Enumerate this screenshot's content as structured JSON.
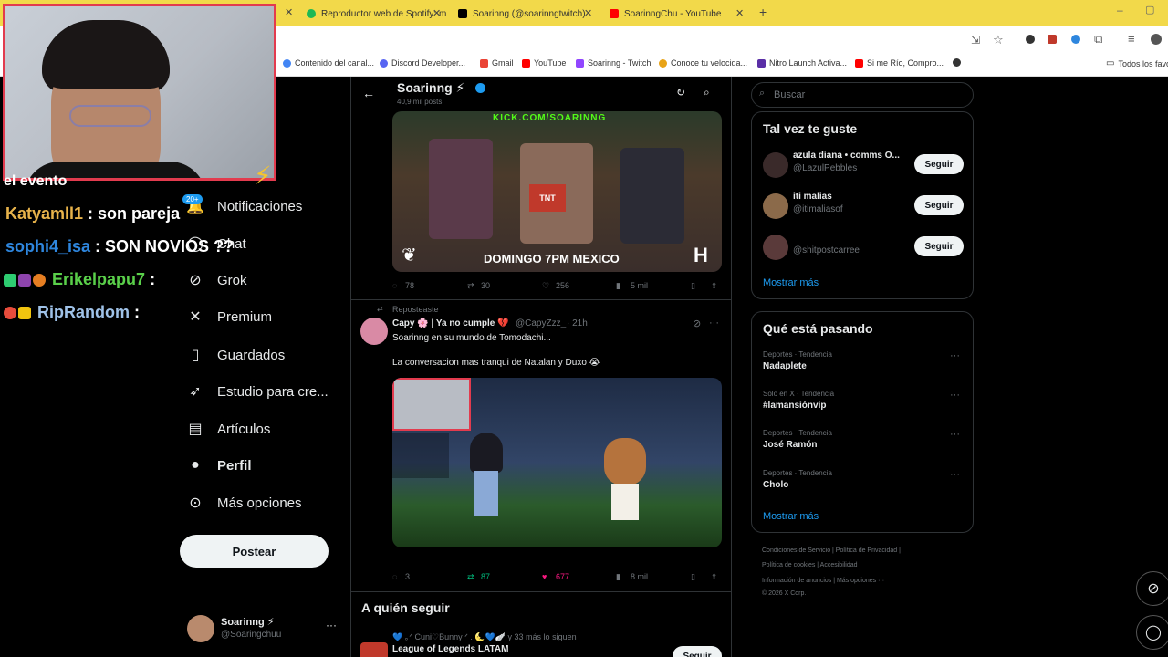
{
  "browser": {
    "tabs": [
      {
        "title": "Reproductor web de Spotify: m",
        "color": "#1db954"
      },
      {
        "title": "Soarinng (@soarinngtwitch) | T",
        "color": "#000000"
      },
      {
        "title": "SoarinngChu - YouTube",
        "color": "#ff0000"
      }
    ],
    "new_tab": "+",
    "bookmarks": [
      {
        "label": "Contenido del canal...",
        "color": "#4285f4"
      },
      {
        "label": "Discord Developer...",
        "color": "#5865f2"
      },
      {
        "label": "Gmail",
        "color": "#ea4335"
      },
      {
        "label": "YouTube",
        "color": "#ff0000"
      },
      {
        "label": "Soarinng - Twitch",
        "color": "#9146ff"
      },
      {
        "label": "Conoce tu velocida...",
        "color": "#e8a317"
      },
      {
        "label": "Nitro Launch Activa...",
        "color": "#5a2ea6"
      },
      {
        "label": "Si me Río, Compro...",
        "color": "#ff0000"
      },
      {
        "label": "",
        "color": "#333333"
      }
    ],
    "all_bookmarks": "Todos los favo"
  },
  "overlay": {
    "chat_top": "el evento",
    "messages": [
      {
        "user": "Katyamll1",
        "text": " : son pareja",
        "color": "#e8b34b"
      },
      {
        "user": "sophi4_isa",
        "text": " : SON NOVIOS ??",
        "color": "#2e86de"
      },
      {
        "user": "Erikelpapu7",
        "text": " :",
        "color": "#5ad04a"
      },
      {
        "user": "RipRandom",
        "text": " :",
        "color": "#9fc2e8"
      }
    ],
    "badge_count": "20+"
  },
  "nav": {
    "items": [
      {
        "label": "Notificaciones",
        "icon": "bell-icon"
      },
      {
        "label": "Chat",
        "icon": "chat-icon"
      },
      {
        "label": "Grok",
        "icon": "grok-icon"
      },
      {
        "label": "Premium",
        "icon": "premium-icon"
      },
      {
        "label": "Guardados",
        "icon": "bookmark-icon"
      },
      {
        "label": "Estudio para cre...",
        "icon": "rocket-icon"
      },
      {
        "label": "Artículos",
        "icon": "article-icon"
      },
      {
        "label": "Perfil",
        "icon": "person-icon"
      },
      {
        "label": "Más opciones",
        "icon": "more-circle-icon"
      }
    ],
    "post_button": "Postear",
    "account": {
      "name": "Soarinng ⚡",
      "handle": "@Soaringchuu"
    }
  },
  "timeline": {
    "profile_name": "Soarinng ⚡",
    "posts_count": "40,9 mil posts",
    "tweet1": {
      "media_caption_top": "KICK.COM/SOARINNG",
      "media_caption_bottom": "DOMINGO 7PM MEXICO",
      "replies": "78",
      "retweets": "30",
      "likes": "256",
      "views": "5 mil"
    },
    "tweet2": {
      "reposted_label": "Reposteaste",
      "author": "Capy 🌸 | Ya no cumple 💔",
      "handle": "@CapyZzz_",
      "time": "· 21h",
      "line1": "Soarinng en su mundo de Tomodachi...",
      "line2": "La conversacion mas tranqui de Natalan y Duxo 😭",
      "replies": "3",
      "retweets": "87",
      "likes": "677",
      "views": "8 mil"
    },
    "who_to_follow": "A quién seguir",
    "wtf_followers": "💙 ｡ᐟ Cuni♡Bunny ᐟ . 🌜💙🪽 y 33 más lo siguen",
    "wtf_name": "League of Legends LATAM",
    "wtf_button": "Seguir"
  },
  "right": {
    "search_placeholder": "Buscar",
    "suggest_title": "Tal vez te guste",
    "suggestions": [
      {
        "name": "azula diana • comms O...",
        "handle": "@LazulPebbles",
        "button": "Seguir"
      },
      {
        "name": "iti malias",
        "handle": "@itimaliasof",
        "button": "Seguir"
      },
      {
        "name": "",
        "handle": "@shitpostcarree",
        "button": "Seguir"
      }
    ],
    "show_more_1": "Mostrar más",
    "trends_title": "Qué está pasando",
    "trends": [
      {
        "context": "Deportes · Tendencia",
        "title": "Nadaplete"
      },
      {
        "context": "Solo en X · Tendencia",
        "title": "#lamansiónvip"
      },
      {
        "context": "Deportes · Tendencia",
        "title": "José Ramón"
      },
      {
        "context": "Deportes · Tendencia",
        "title": "Cholo"
      }
    ],
    "show_more_2": "Mostrar más",
    "footer": [
      "Condiciones de Servicio  |   Política de Privacidad  |",
      "Política de cookies   |   Accesibilidad   |",
      "Información de anuncios  |   Más opciones ···",
      "© 2026 X Corp."
    ]
  }
}
